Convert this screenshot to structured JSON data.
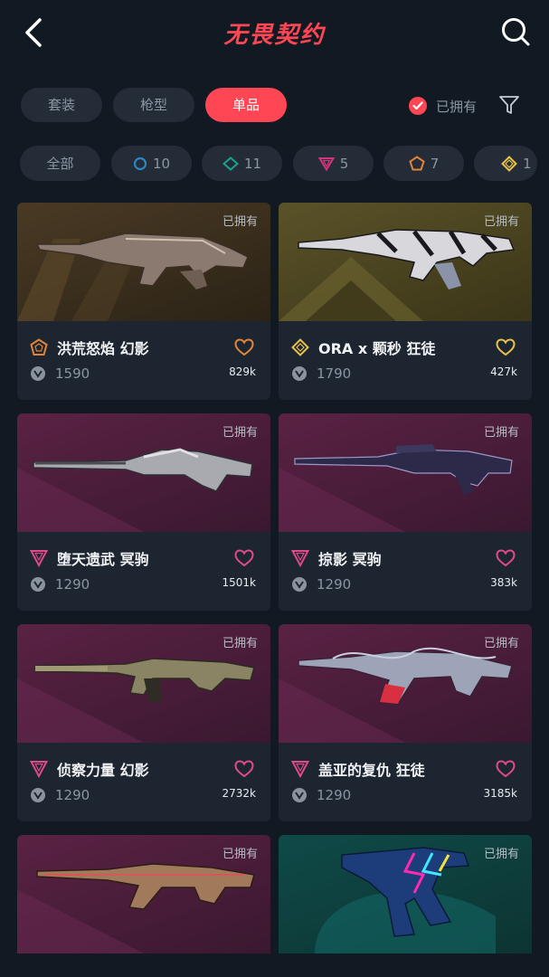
{
  "header": {
    "title": "无畏契约"
  },
  "segments": [
    {
      "label": "套装",
      "active": false
    },
    {
      "label": "枪型",
      "active": false
    },
    {
      "label": "单品",
      "active": true
    }
  ],
  "owned_filter": {
    "label": "已拥有",
    "checked": true
  },
  "tiers": [
    {
      "label": "全部",
      "icon": ""
    },
    {
      "label": "10",
      "icon": "select-tier-icon",
      "color": "#2e86c1"
    },
    {
      "label": "11",
      "icon": "deluxe-tier-icon",
      "color": "#1aa38c"
    },
    {
      "label": "5",
      "icon": "premium-tier-icon",
      "color": "#d2357e"
    },
    {
      "label": "7",
      "icon": "exclusive-tier-icon",
      "color": "#e0843b"
    },
    {
      "label": "1",
      "icon": "ultra-tier-icon",
      "color": "#e8c14b"
    }
  ],
  "cards": [
    {
      "owned": "已拥有",
      "name": "洪荒怒焰 幻影",
      "price": "1590",
      "likes": "829k",
      "tier": "exclusive",
      "liked_color": "#e0843b"
    },
    {
      "owned": "已拥有",
      "name": "ORA x 颗秒 狂徒",
      "price": "1790",
      "likes": "427k",
      "tier": "ultra",
      "liked_color": "#e8c14b"
    },
    {
      "owned": "已拥有",
      "name": "堕天遗武 冥驹",
      "price": "1290",
      "likes": "1501k",
      "tier": "premium",
      "liked_color": "#e04a8a"
    },
    {
      "owned": "已拥有",
      "name": "掠影 冥驹",
      "price": "1290",
      "likes": "383k",
      "tier": "premium",
      "liked_color": "#e04a8a"
    },
    {
      "owned": "已拥有",
      "name": "侦察力量 幻影",
      "price": "1290",
      "likes": "2732k",
      "tier": "premium",
      "liked_color": "#e04a8a"
    },
    {
      "owned": "已拥有",
      "name": "盖亚的复仇 狂徒",
      "price": "1290",
      "likes": "3185k",
      "tier": "premium",
      "liked_color": "#e04a8a"
    },
    {
      "owned": "已拥有",
      "name": "",
      "price": "",
      "likes": "",
      "tier": "premium",
      "liked_color": "#e04a8a"
    },
    {
      "owned": "已拥有",
      "name": "",
      "price": "",
      "likes": "",
      "tier": "deluxe",
      "liked_color": "#1aa38c"
    }
  ],
  "colors": {
    "accent": "#ff4655",
    "background": "#111923",
    "card": "#1c2530",
    "chip": "#232c37"
  }
}
